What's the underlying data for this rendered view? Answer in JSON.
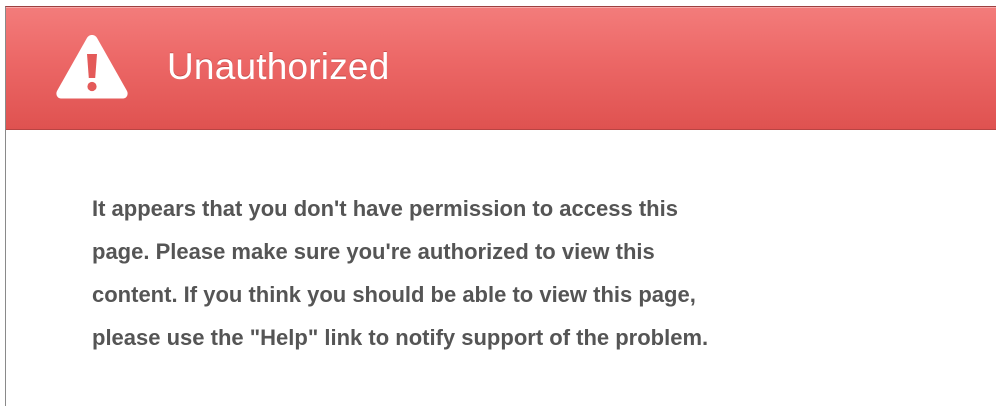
{
  "header": {
    "icon": "warning-triangle-icon",
    "title": "Unauthorized",
    "colors": {
      "background": "#ea6463",
      "text": "#ffffff"
    }
  },
  "body": {
    "message_lines": [
      "It appears that you don't have permission to access this",
      "page. Please make sure you're authorized to view this",
      "content. If you think you should be able to view this page,",
      "please use the \"Help\" link to notify support of the problem."
    ],
    "text_color": "#555555"
  }
}
